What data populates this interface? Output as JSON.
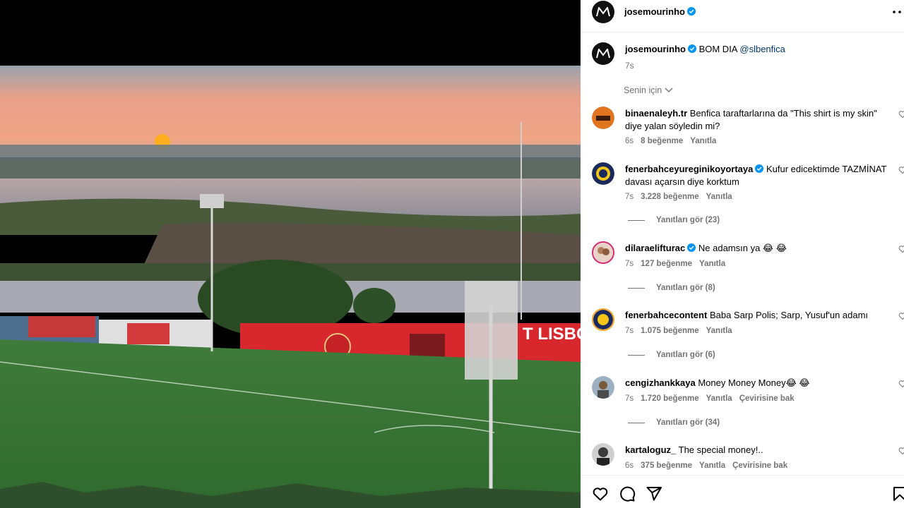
{
  "post": {
    "username": "josemourinho",
    "verified": true,
    "caption_text": "BOM DIA",
    "caption_mention": "@slbenfica",
    "caption_time": "7s",
    "photo_sign": "T LISBOA"
  },
  "sort": {
    "label": "Senin için"
  },
  "comments": [
    {
      "username": "binaenaleyh.tr",
      "verified": false,
      "text": "Benfica taraftarlarına da \"This shirt is my skin\" diye yalan söyledin mi?",
      "time": "6s",
      "likes": "8 beğenme",
      "reply": "Yanıtla",
      "translate": ""
    },
    {
      "username": "fenerbahceyureginikoyortaya",
      "verified": true,
      "text": "Kufur edicektimde TAZMİNAT davası açarsın diye korktum",
      "time": "7s",
      "likes": "3.228 beğenme",
      "reply": "Yanıtla",
      "translate": "",
      "replies": "Yanıtları gör (23)"
    },
    {
      "username": "dilaraelifturac",
      "verified": true,
      "text": "Ne adamsın ya 😂 😂",
      "time": "7s",
      "likes": "127 beğenme",
      "reply": "Yanıtla",
      "translate": "",
      "replies": "Yanıtları gör (8)"
    },
    {
      "username": "fenerbahcecontent",
      "verified": false,
      "text": "Baba Sarp Polis; Sarp, Yusuf'un adamı",
      "time": "7s",
      "likes": "1.075 beğenme",
      "reply": "Yanıtla",
      "translate": "",
      "replies": "Yanıtları gör (6)"
    },
    {
      "username": "cengizhankkaya",
      "verified": false,
      "text": "Money Money Money😂 😂",
      "time": "7s",
      "likes": "1.720 beğenme",
      "reply": "Yanıtla",
      "translate": "Çevirisine bak",
      "replies": "Yanıtları gör (34)"
    },
    {
      "username": "kartaloguz_",
      "verified": false,
      "text": "The special money!..",
      "time": "6s",
      "likes": "375 beğenme",
      "reply": "Yanıtla",
      "translate": "Çevirisine bak"
    }
  ],
  "colors": {
    "verified": "#0095f6",
    "muted": "#737373",
    "link": "#00376b",
    "benfica_red": "#d9272e"
  },
  "icons": {
    "like": "heart-icon",
    "comment": "comment-icon",
    "share": "send-icon",
    "save": "bookmark-icon",
    "more": "more-horizontal-icon"
  }
}
